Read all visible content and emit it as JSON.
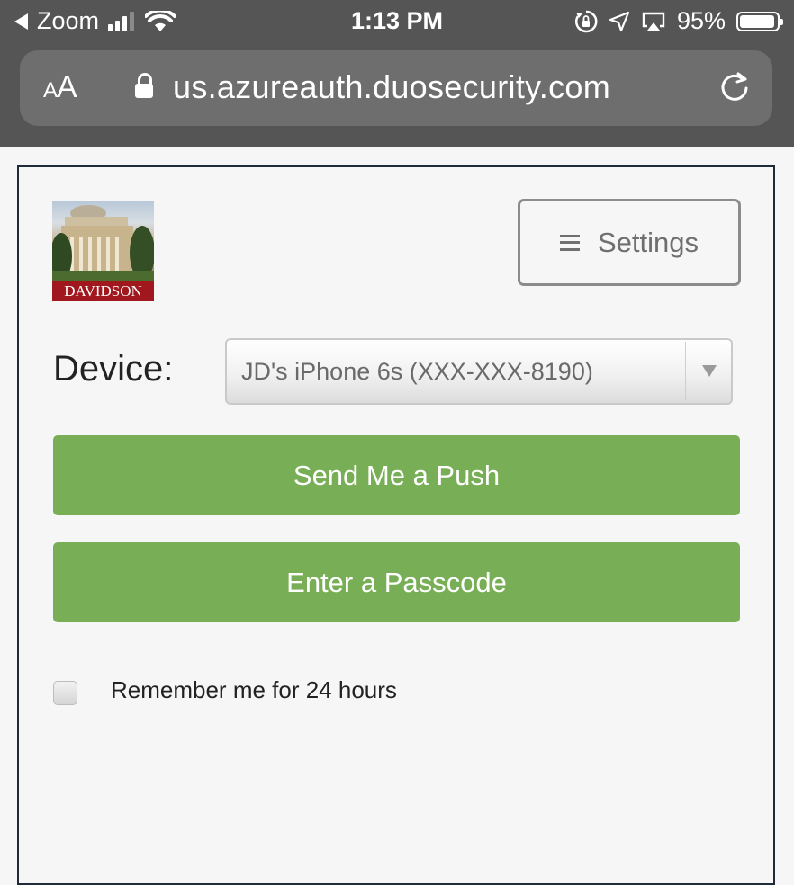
{
  "status_bar": {
    "back_app": "Zoom",
    "time": "1:13 PM",
    "battery": "95%",
    "battery_level": 0.95,
    "icons": [
      "back-arrow-icon",
      "cellular-signal-icon",
      "wifi-icon",
      "orientation-lock-icon",
      "location-arrow-icon",
      "airplay-icon",
      "battery-icon"
    ]
  },
  "browser": {
    "text_size_small": "A",
    "text_size_large": "A",
    "url": "us.azureauth.duosecurity.com",
    "icons": [
      "lock-icon",
      "reload-icon"
    ]
  },
  "duo": {
    "logo_text": "DAVIDSON",
    "settings_label": "Settings",
    "device_label": "Device:",
    "device_selected": "JD's iPhone 6s (XXX-XXX-8190)",
    "push_button": "Send Me a Push",
    "passcode_button": "Enter a Passcode",
    "remember_label": "Remember me for 24 hours",
    "remember_checked": false
  },
  "colors": {
    "chrome": "#555555",
    "accent_green": "#78af56",
    "brand_red": "#a0171e"
  }
}
